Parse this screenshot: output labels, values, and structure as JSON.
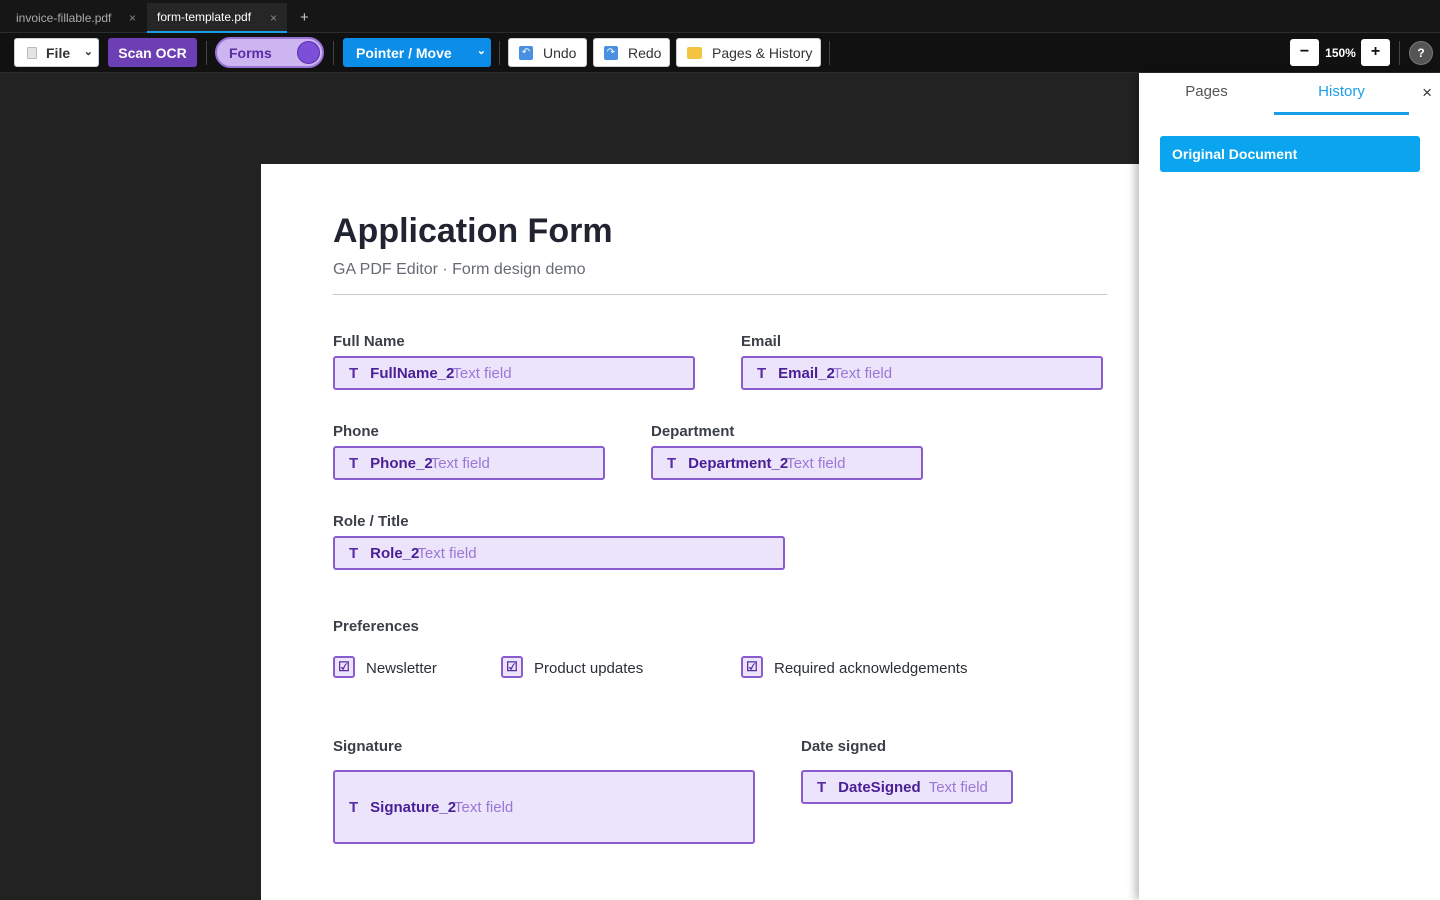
{
  "tabs": [
    {
      "label": "invoice-fillable.pdf",
      "close": "×"
    },
    {
      "label": "form-template.pdf",
      "close": "×"
    }
  ],
  "tab_add": "+",
  "toolbar": {
    "file_label": "File",
    "chevron": "⌄",
    "ocr_label": "Scan OCR",
    "forms_label": "Forms",
    "pointer_label": "Pointer / Move",
    "undo_label": "Undo",
    "redo_label": "Redo",
    "pages_history_label": "Pages & History",
    "zoom_minus": "−",
    "zoom_value": "150%",
    "zoom_plus": "+",
    "help": "?"
  },
  "document": {
    "title": "Application Form",
    "subtitle": "GA PDF Editor · Form design demo",
    "field_type_glyph": "T",
    "fields": {
      "full_name": {
        "label": "Full Name",
        "name": "FullName_2",
        "placeholder": "Text field"
      },
      "email": {
        "label": "Email",
        "name": "Email_2",
        "placeholder": "Text field"
      },
      "phone": {
        "label": "Phone",
        "name": "Phone_2",
        "placeholder": "Text field"
      },
      "department": {
        "label": "Department",
        "name": "Department_2",
        "placeholder": "Text field"
      },
      "role": {
        "label": "Role / Title",
        "name": "Role_2",
        "placeholder": "Text field"
      },
      "signature": {
        "label": "Signature",
        "name": "Signature_2",
        "placeholder": "Text field"
      },
      "date_signed": {
        "label": "Date signed",
        "name": "DateSigned",
        "placeholder": "Text field"
      }
    },
    "preferences": {
      "heading": "Preferences",
      "check_glyph": "☑",
      "items": [
        "Newsletter",
        "Product updates",
        "Required acknowledgements"
      ]
    }
  },
  "panel": {
    "tab_pages": "Pages",
    "tab_history": "History",
    "close": "×",
    "history_items": [
      "Original Document"
    ]
  },
  "colors": {
    "accent": "#1a9ee8",
    "ocr": "#6d3fb5",
    "form_field_bg": "#ece4fb",
    "form_field_border": "#8a5cd0"
  }
}
